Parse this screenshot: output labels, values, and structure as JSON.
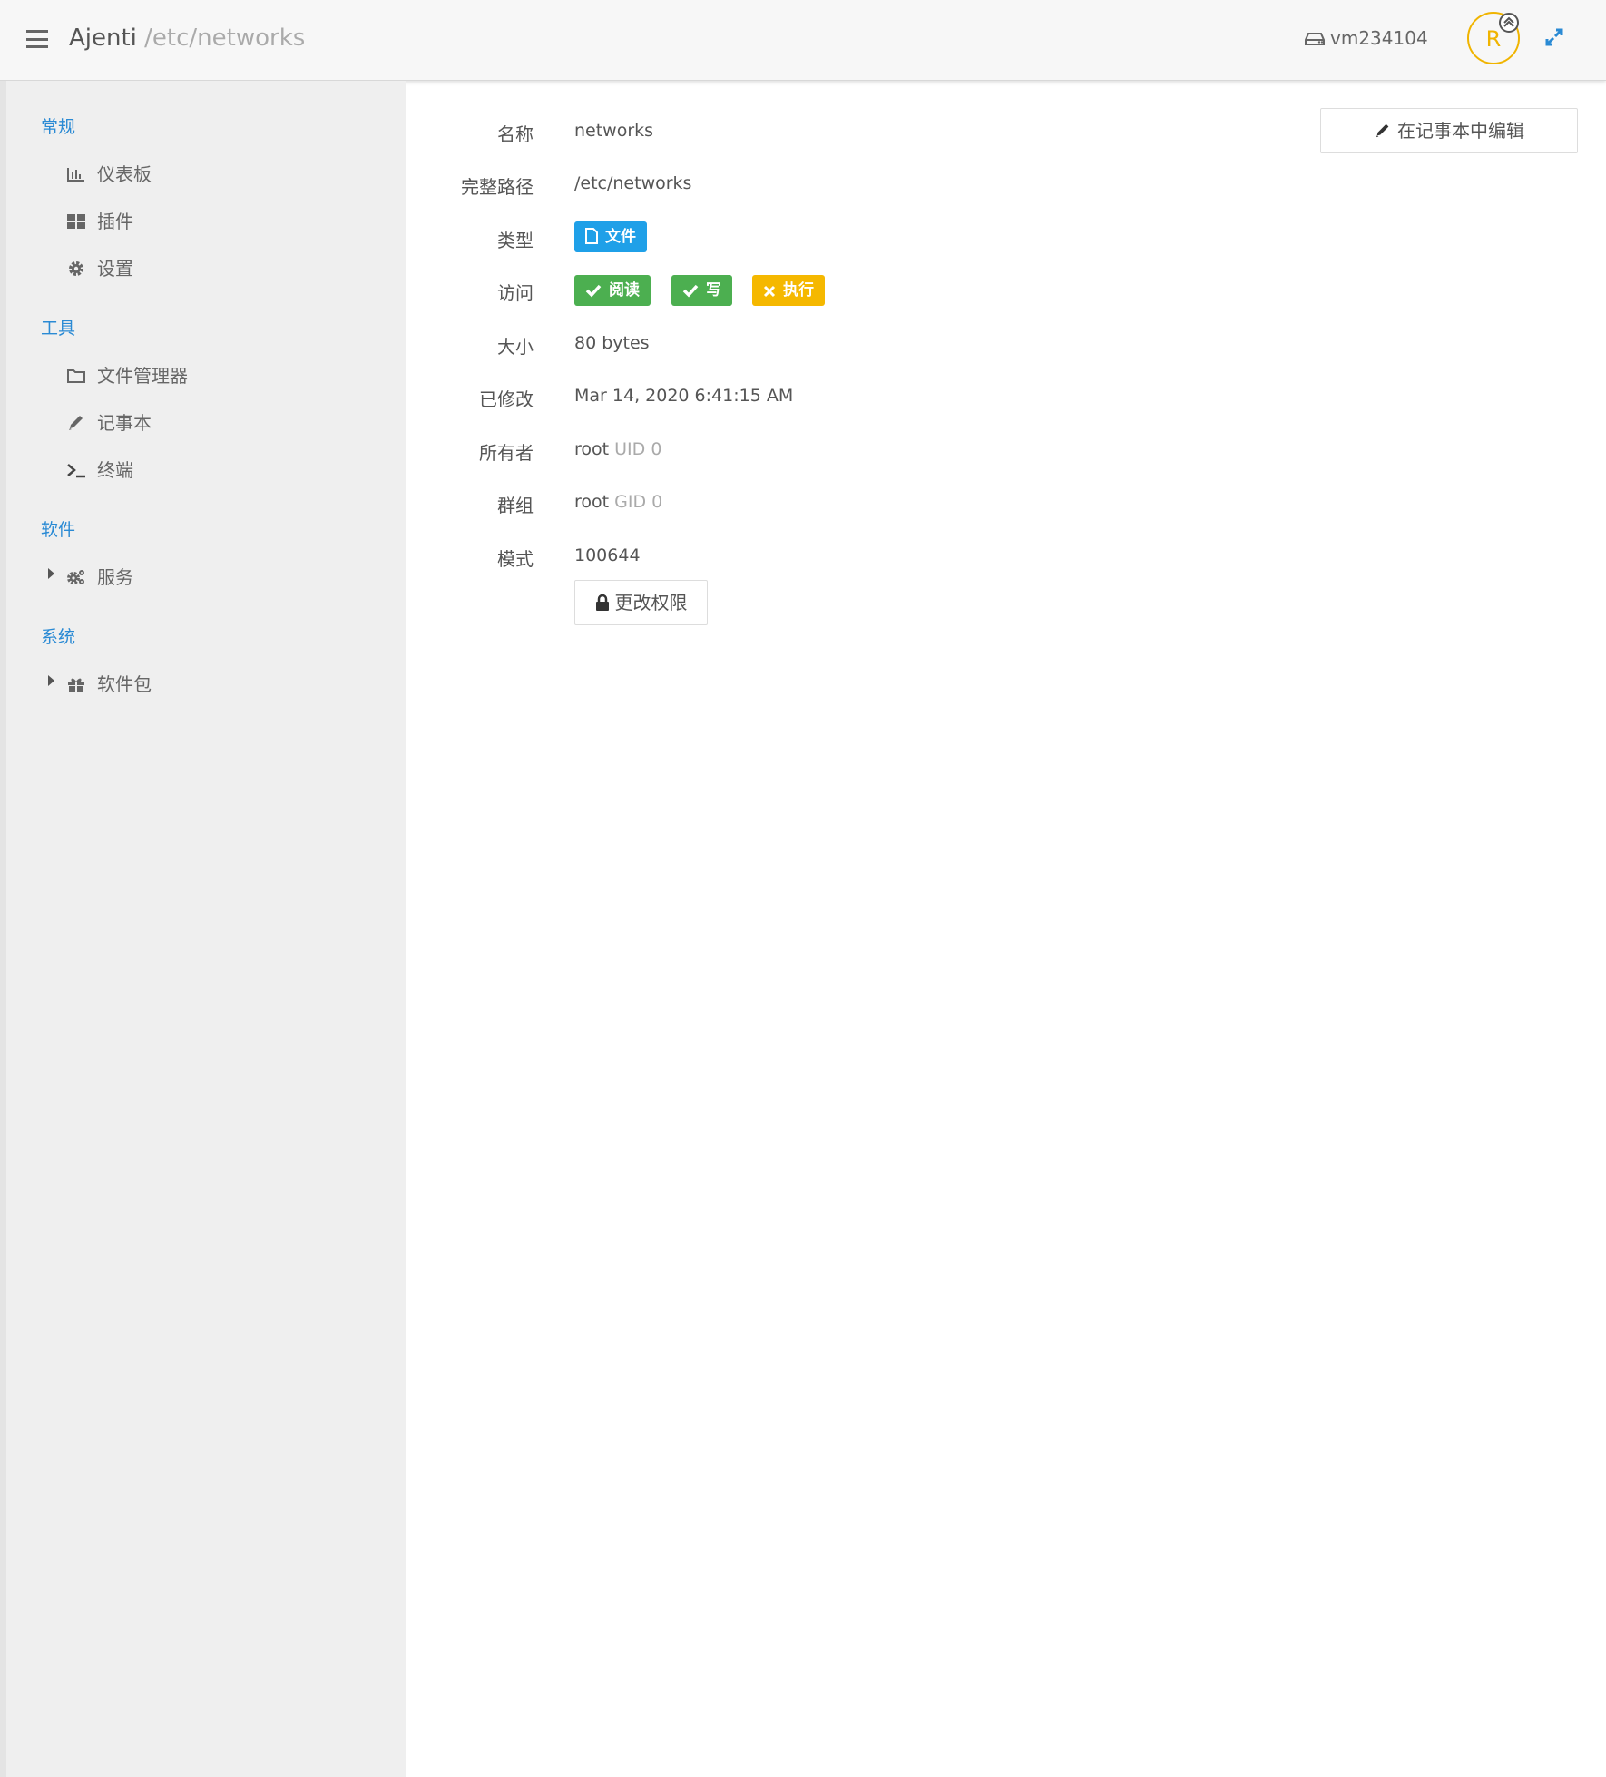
{
  "header": {
    "app_name": "Ajenti",
    "path": "/etc/networks",
    "host": "vm234104",
    "avatar_letter": "R"
  },
  "sidebar": {
    "sections": [
      {
        "title": "常规",
        "items": [
          {
            "label": "仪表板",
            "icon": "bar-chart-icon"
          },
          {
            "label": "插件",
            "icon": "grid-icon"
          },
          {
            "label": "设置",
            "icon": "gear-icon"
          }
        ]
      },
      {
        "title": "工具",
        "items": [
          {
            "label": "文件管理器",
            "icon": "folder-icon"
          },
          {
            "label": "记事本",
            "icon": "pencil-icon"
          },
          {
            "label": "终端",
            "icon": "terminal-icon"
          }
        ]
      },
      {
        "title": "软件",
        "items": [
          {
            "label": "服务",
            "icon": "gears-icon"
          }
        ]
      },
      {
        "title": "系统",
        "items": [
          {
            "label": "软件包",
            "icon": "gift-icon"
          }
        ]
      }
    ]
  },
  "main": {
    "edit_button": "在记事本中编辑",
    "fields": {
      "name": {
        "label": "名称",
        "value": "networks"
      },
      "full_path": {
        "label": "完整路径",
        "value": "/etc/networks"
      },
      "type": {
        "label": "类型",
        "value": "文件"
      },
      "access": {
        "label": "访问",
        "read": "阅读",
        "write": "写",
        "execute": "执行"
      },
      "size": {
        "label": "大小",
        "value": "80 bytes"
      },
      "modified": {
        "label": "已修改",
        "value": "Mar 14, 2020 6:41:15 AM"
      },
      "owner": {
        "label": "所有者",
        "value": "root",
        "uid": "UID 0"
      },
      "group": {
        "label": "群组",
        "value": "root",
        "gid": "GID 0"
      },
      "mode": {
        "label": "模式",
        "value": "100644"
      }
    },
    "change_permissions_button": "更改权限"
  },
  "colors": {
    "accent": "#2a8ad4",
    "badge_blue": "#1fa0e8",
    "badge_green": "#4caf50",
    "badge_yellow": "#f5b800",
    "avatar": "#f0b400"
  }
}
